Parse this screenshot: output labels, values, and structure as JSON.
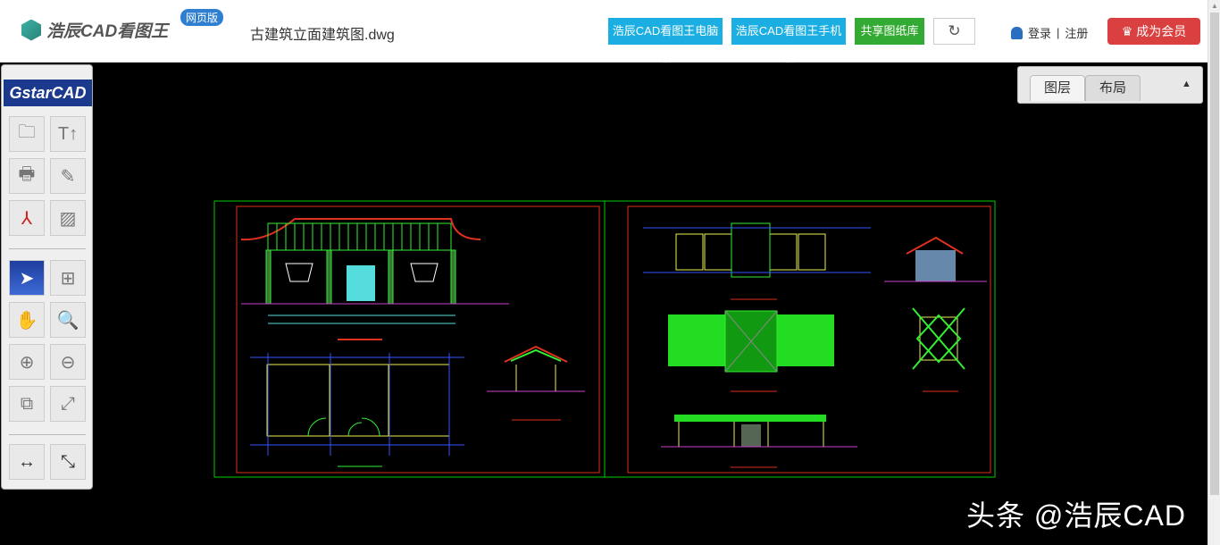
{
  "header": {
    "brand": "浩辰CAD看图王",
    "web_tag": "网页版",
    "file_name": "古建筑立面建筑图.dwg",
    "buttons": [
      {
        "label": "浩辰CAD看图王电脑版",
        "color": "#1aaee2"
      },
      {
        "label": "浩辰CAD看图王手机版",
        "color": "#1aaee2"
      },
      {
        "label": "共享图纸库",
        "color": "#33aa33"
      }
    ],
    "refresh_icon": "refresh-icon",
    "login": "登录",
    "sep": "|",
    "register": "注册",
    "vip": "成为会员",
    "vip_color": "#d9403f"
  },
  "toolbar": {
    "logo": "GstarCAD",
    "tools": [
      "open-folder",
      "text-upload",
      "print",
      "save-edit",
      "pdf",
      "image-export",
      "select",
      "zoom-window",
      "pan",
      "zoom-extents",
      "zoom-in",
      "zoom-out",
      "switch-view",
      "fullscreen",
      "measure-distance",
      "measure-aligned"
    ],
    "active": "select"
  },
  "panel": {
    "tabs": [
      "图层",
      "布局"
    ],
    "selected": "图层"
  },
  "watermark": "头条 @浩辰CAD",
  "drawing": {
    "background": "#000000",
    "sheet_frame": "#00cc00",
    "inner_frame": "#e03020"
  }
}
